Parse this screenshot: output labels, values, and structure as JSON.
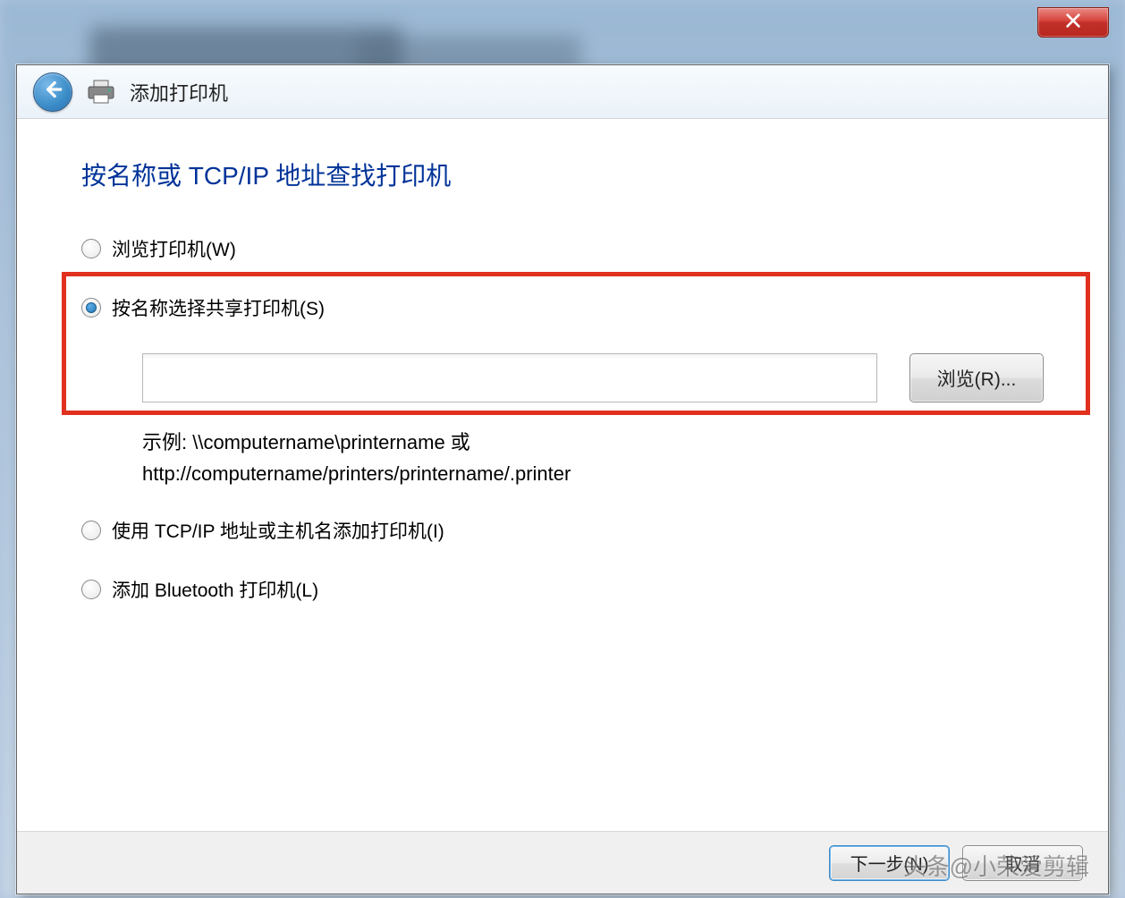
{
  "window": {
    "title": "添加打印机"
  },
  "main": {
    "heading": "按名称或 TCP/IP 地址查找打印机",
    "options": {
      "browse": "浏览打印机(W)",
      "share": "按名称选择共享打印机(S)",
      "tcpip": "使用 TCP/IP 地址或主机名添加打印机(I)",
      "bluetooth": "添加 Bluetooth 打印机(L)"
    },
    "share_input": {
      "value": "",
      "browse_button": "浏览(R)...",
      "example_line1": "示例: \\\\computername\\printername 或",
      "example_line2": "http://computername/printers/printername/.printer"
    }
  },
  "footer": {
    "next": "下一步(N)",
    "cancel": "取消"
  },
  "watermark": "头条@小荣爱剪辑"
}
